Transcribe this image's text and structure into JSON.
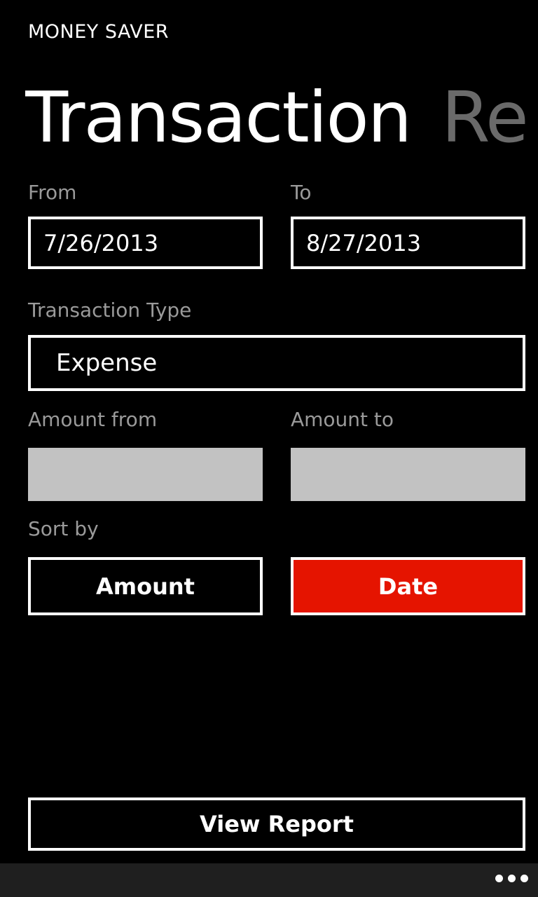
{
  "app": {
    "title": "MONEY SAVER"
  },
  "pivot": {
    "items": [
      {
        "label": "Transaction",
        "active": true
      },
      {
        "label": "Re",
        "active": false
      }
    ]
  },
  "filters": {
    "from": {
      "label": "From",
      "value": "7/26/2013"
    },
    "to": {
      "label": "To",
      "value": "8/27/2013"
    },
    "transaction_type": {
      "label": "Transaction Type",
      "value": "Expense"
    },
    "amount_from": {
      "label": "Amount from",
      "value": ""
    },
    "amount_to": {
      "label": "Amount to",
      "value": ""
    }
  },
  "sort": {
    "label": "Sort by",
    "options": [
      {
        "label": "Amount",
        "selected": false
      },
      {
        "label": "Date",
        "selected": true
      }
    ]
  },
  "actions": {
    "view_report_label": "View Report"
  },
  "appbar": {
    "more_icon": "more-ellipsis-icon"
  },
  "colors": {
    "background": "#000000",
    "accent": "#e51400",
    "label": "#9a9a9a",
    "input_disabled": "#c2c2c2",
    "appbar": "#1f1f1f"
  }
}
